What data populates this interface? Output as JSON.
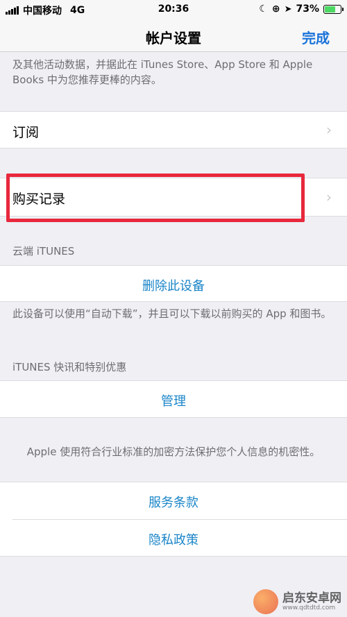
{
  "status_bar": {
    "carrier": "中国移动",
    "network": "4G",
    "time": "20:36",
    "battery_pct": "73%",
    "battery_level": 0.73
  },
  "nav": {
    "title": "帐户设置",
    "done_label": "完成"
  },
  "intro_text": "及其他活动数据，并据此在 iTunes Store、App Store 和 Apple Books 中为您推荐更棒的内容。",
  "rows": {
    "subscriptions": "订阅",
    "purchase_history": "购买记录"
  },
  "cloud_section": {
    "header": "云端 iTUNES",
    "remove_device": "删除此设备",
    "footer": "此设备可以使用“自动下载”，并且可以下载以前购买的 App 和图书。"
  },
  "news_section": {
    "header": "iTUNES 快讯和特别优惠",
    "manage": "管理"
  },
  "privacy_text": "Apple 使用符合行业标准的加密方法保护您个人信息的机密性。",
  "legal": {
    "terms": "服务条款",
    "privacy_policy": "隐私政策"
  },
  "watermark": {
    "name": "启东安卓网",
    "url": "www.qdtdtd.com"
  },
  "colors": {
    "accent": "#1a85c8",
    "done": "#1a73d9",
    "highlight": "#e8283c",
    "battery": "#4cd964"
  }
}
